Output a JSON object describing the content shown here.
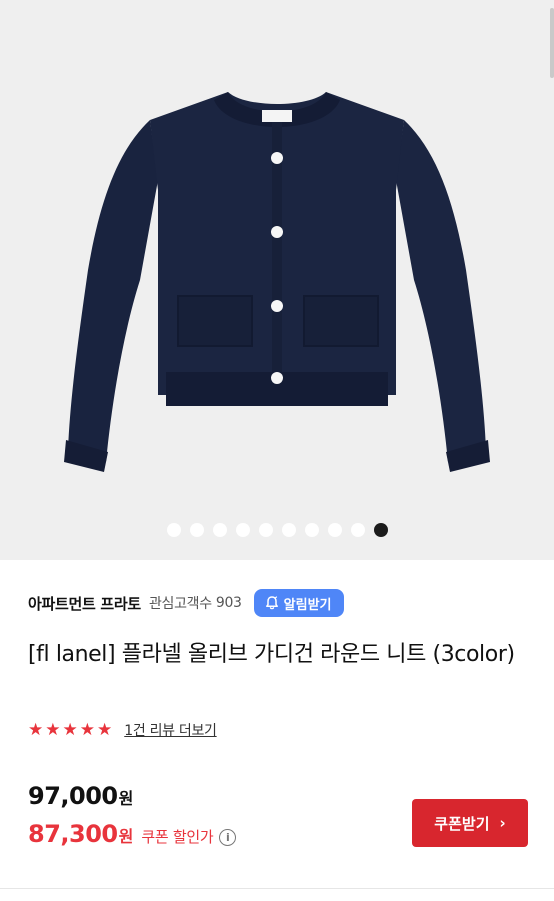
{
  "gallery": {
    "image_alt": "navy cardigan",
    "dot_count": 10,
    "active_index": 9
  },
  "seller": {
    "name": "아파트먼트 프라토",
    "interest_label": "관심고객수",
    "interest_count": "903",
    "alarm_label": "알림받기"
  },
  "product": {
    "title": "[fl lanel] 플라넬 올리브 가디건 라운드 니트 (3color)",
    "rating_stars": 5,
    "review_link": "1건 리뷰 더보기"
  },
  "price": {
    "original": "97,000",
    "unit": "원",
    "discounted": "87,300",
    "discount_label": "쿠폰 할인가",
    "info_icon": "i"
  },
  "coupon": {
    "label": "쿠폰받기",
    "chevron": "›"
  },
  "colors": {
    "accent_red": "#d8262e",
    "alarm_blue": "#4f86f7",
    "star_red": "#e8343c",
    "garment_navy": "#19233f"
  }
}
